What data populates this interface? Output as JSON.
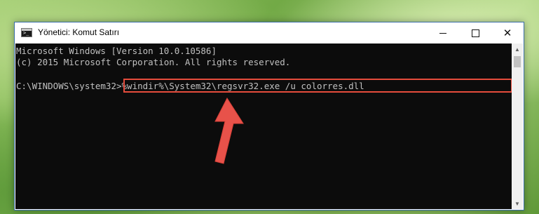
{
  "window": {
    "title": "Yönetici: Komut Satırı",
    "buttons": {
      "minimize": "—",
      "maximize": "☐",
      "close": "✕"
    }
  },
  "console": {
    "lines": [
      "Microsoft Windows [Version 10.0.10586]",
      "(c) 2015 Microsoft Corporation. All rights reserved."
    ],
    "prompt": "C:\\WINDOWS\\system32>",
    "command": "%windir%\\System32\\regsvr32.exe /u colorres.dll"
  },
  "colors": {
    "highlight": "#e54c3c",
    "console_bg": "#0c0c0c",
    "console_text": "#c0c0c0",
    "arrow": "#e8524a"
  },
  "icons": {
    "app": "cmd-icon",
    "scroll_up": "scroll-up-arrow-icon",
    "scroll_down": "scroll-down-arrow-icon",
    "pointer": "red-arrow-icon"
  }
}
